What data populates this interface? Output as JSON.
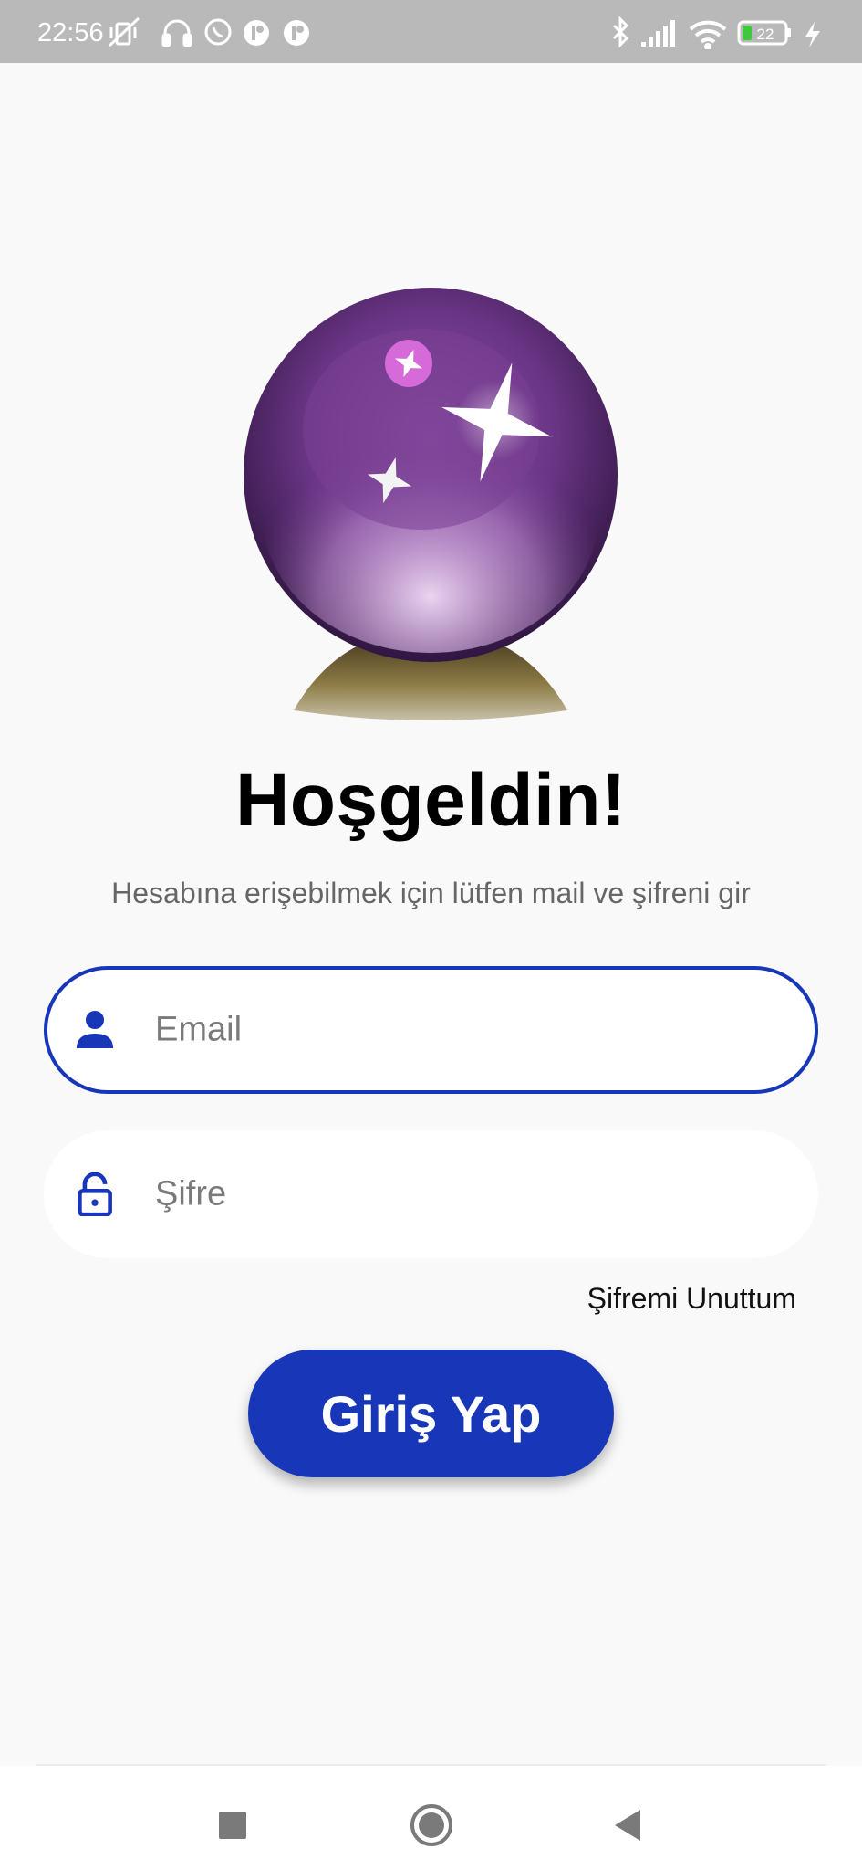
{
  "status_bar": {
    "time": "22:56",
    "battery": "22",
    "left_icons": [
      "vibrate-off-icon",
      "headphones-icon",
      "whatsapp-icon",
      "app-notification-icon",
      "app-notification-icon"
    ],
    "right_icons": [
      "bluetooth-icon",
      "signal-icon",
      "wifi-icon",
      "battery-icon",
      "charging-icon"
    ]
  },
  "login": {
    "title": "Hoşgeldin!",
    "subtitle": "Hesabına erişebilmek için lütfen mail ve şifreni gir",
    "email_placeholder": "Email",
    "password_placeholder": "Şifre",
    "forgot_label": "Şifremi Unuttum",
    "login_label": "Giriş Yap"
  },
  "colors": {
    "accent": "#1836b8",
    "background": "#f9f9f9",
    "status_bar": "#b9b9b9"
  },
  "nav": {
    "icons": [
      "recents-square-icon",
      "home-circle-icon",
      "back-triangle-icon"
    ]
  }
}
